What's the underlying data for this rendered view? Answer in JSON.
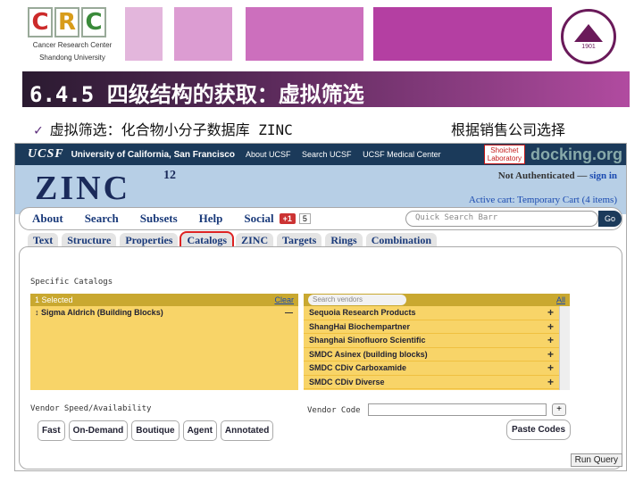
{
  "header": {
    "logo_letters": [
      "C",
      "R",
      "C"
    ],
    "logo_sub1": "Cancer Research Center",
    "logo_sub2": "Shandong University",
    "seal_year": "1901",
    "title": "6.4.5 四级结构的获取：虚拟筛选",
    "bullet_left": "虚拟筛选：化合物小分子数据库 ZINC",
    "bullet_right": "根据销售公司选择"
  },
  "ucsf_bar": {
    "logo": "UCSF",
    "links": [
      "University of California, San Francisco",
      "About UCSF",
      "Search UCSF",
      "UCSF Medical Center"
    ],
    "shoichet_line1": "Shoichet",
    "shoichet_line2": "Laboratory",
    "docking": "docking.org"
  },
  "zinc": {
    "logo": "ZINC",
    "version": "12",
    "auth_text": "Not Authenticated —",
    "signin": "sign in",
    "cart": "Active cart: Temporary Cart (4 items)"
  },
  "nav": {
    "main": [
      "About",
      "Search",
      "Subsets",
      "Help",
      "Social"
    ],
    "gplus": "+1",
    "gcount": "5",
    "quick_search": "Quick Search Barr",
    "go": "Go",
    "sub": [
      "Text",
      "Structure",
      "Properties",
      "Catalogs",
      "ZINC",
      "Targets",
      "Rings",
      "Combination"
    ],
    "active_sub": "Catalogs"
  },
  "catalogs": {
    "specific_label": "Specific Catalogs",
    "selected_header": "1 Selected",
    "clear": "Clear",
    "selected_items": [
      {
        "name": "Sigma Aldrich (Building Blocks)",
        "action": "—"
      }
    ],
    "search_placeholder": "Search vendors",
    "all": "All",
    "vendors": [
      "Sequoia Research Products",
      "ShangHai Biochempartner",
      "Shanghai Sinofluoro Scientific",
      "SMDC Asinex (building blocks)",
      "SMDC CDiv Carboxamide",
      "SMDC CDiv Diverse"
    ],
    "plus": "+"
  },
  "speed": {
    "label": "Vendor Speed/Availability",
    "buttons": [
      "Fast",
      "On-Demand",
      "Boutique",
      "Agent",
      "Annotated"
    ]
  },
  "vendor_code": {
    "label": "Vendor Code",
    "plus": "+",
    "paste": "Paste Codes"
  },
  "run_query": "Run Query"
}
